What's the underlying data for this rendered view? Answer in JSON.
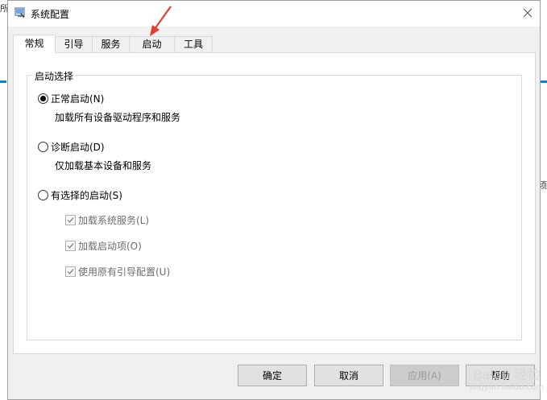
{
  "window": {
    "title": "系统配置"
  },
  "tabs": [
    {
      "label": "常规",
      "active": true
    },
    {
      "label": "引导",
      "active": false
    },
    {
      "label": "服务",
      "active": false
    },
    {
      "label": "启动",
      "active": false
    },
    {
      "label": "工具",
      "active": false
    }
  ],
  "general": {
    "group_title": "启动选择",
    "options": [
      {
        "label": "正常启动(N)",
        "description": "加载所有设备驱动程序和服务",
        "selected": true
      },
      {
        "label": "诊断启动(D)",
        "description": "仅加载基本设备和服务",
        "selected": false
      },
      {
        "label": "有选择的启动(S)",
        "selected": false
      }
    ],
    "selective_items": [
      {
        "label": "加载系统服务(L)",
        "checked": true,
        "enabled": false
      },
      {
        "label": "加载启动项(O)",
        "checked": true,
        "enabled": false
      },
      {
        "label": "使用原有引导配置(U)",
        "checked": true,
        "enabled": false
      }
    ]
  },
  "buttons": {
    "ok": "确定",
    "cancel": "取消",
    "apply": "应用(A)",
    "help": "帮助"
  },
  "background": {
    "left_glyph": "所",
    "right_glyph": "须"
  },
  "watermark": {
    "brand": "Baidu 经验",
    "url": "jingyan.baidu.com"
  },
  "colors": {
    "accent_blue": "#0a84d8",
    "annotation_arrow": "#e83a2e"
  }
}
